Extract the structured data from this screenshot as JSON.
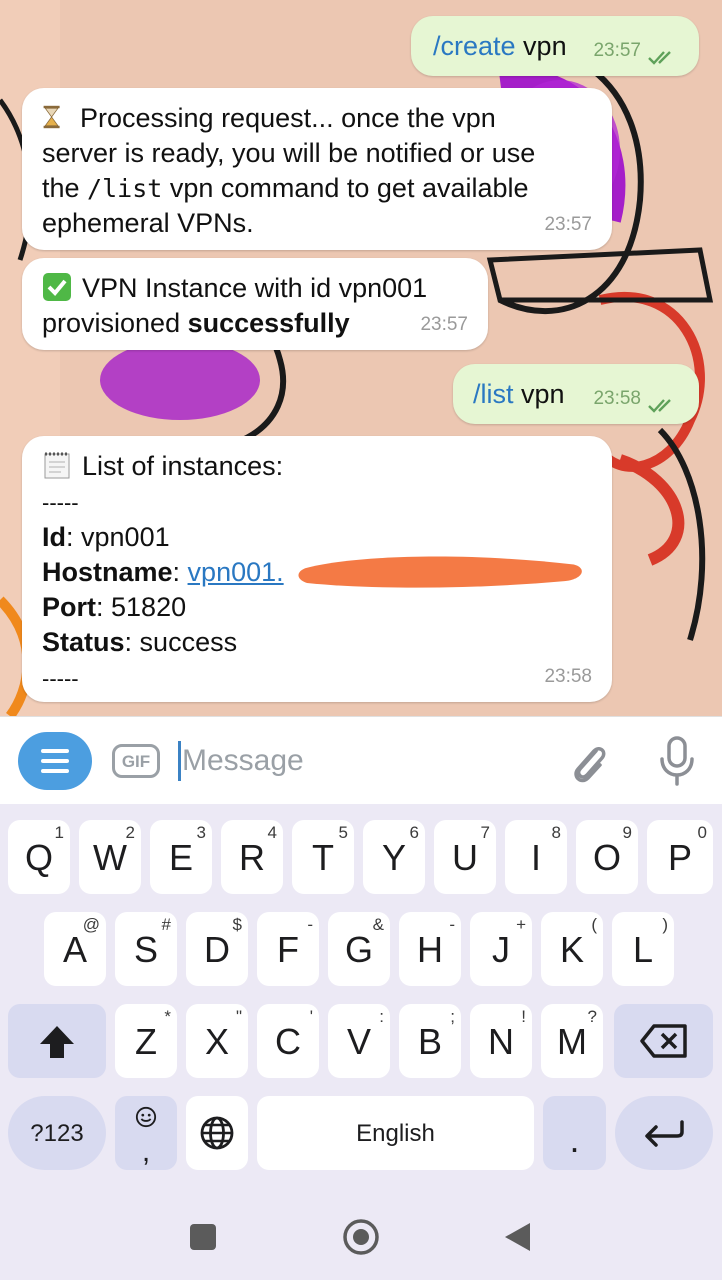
{
  "messages": {
    "out1": {
      "command": "/create",
      "text": " vpn",
      "time": "23:57"
    },
    "in1": {
      "line1": "Processing request... once the vpn",
      "line2": "server is ready, you will be notified or use",
      "line3_pre": "the ",
      "line3_code": "/list",
      "line3_post": " vpn command to get available",
      "line4": "ephemeral VPNs.",
      "time": "23:57"
    },
    "in2": {
      "line1": "VPN Instance with id vpn001",
      "line2_pre": "provisioned ",
      "line2_bold": "successfully",
      "time": "23:57"
    },
    "out2": {
      "command": "/list",
      "text": " vpn",
      "time": "23:58"
    },
    "in3": {
      "title": "List of instances:",
      "separator": "-----",
      "id_label": "Id",
      "id_value": " vpn001",
      "hostname_label": "Hostname",
      "hostname_value": "vpn001.",
      "port_label": "Port",
      "port_value": " 51820",
      "status_label": "Status",
      "status_value": " success",
      "separator_end": "-----",
      "time": "23:58"
    }
  },
  "composer": {
    "gif_label": "GIF",
    "placeholder": "Message"
  },
  "keyboard": {
    "row1": [
      [
        "Q",
        "1"
      ],
      [
        "W",
        "2"
      ],
      [
        "E",
        "3"
      ],
      [
        "R",
        "4"
      ],
      [
        "T",
        "5"
      ],
      [
        "Y",
        "6"
      ],
      [
        "U",
        "7"
      ],
      [
        "I",
        "8"
      ],
      [
        "O",
        "9"
      ],
      [
        "P",
        "0"
      ]
    ],
    "row2": [
      [
        "A",
        "@"
      ],
      [
        "S",
        "#"
      ],
      [
        "D",
        "$"
      ],
      [
        "F",
        "-"
      ],
      [
        "G",
        "&"
      ],
      [
        "H",
        "-"
      ],
      [
        "J",
        "+"
      ],
      [
        "K",
        "("
      ],
      [
        "L",
        ")"
      ]
    ],
    "row3": [
      [
        "Z",
        "*"
      ],
      [
        "X",
        "\""
      ],
      [
        "C",
        "'"
      ],
      [
        "V",
        ":"
      ],
      [
        "B",
        ";"
      ],
      [
        "N",
        "!"
      ],
      [
        "M",
        "?"
      ]
    ],
    "symbols_label": "?123",
    "space_label": "English",
    "period_label": ".",
    "comma_label": ","
  },
  "colors": {
    "accent": "#4c9ee0",
    "link": "#2a78c2",
    "outgoing_bubble": "#e6f6d3",
    "redaction": "#f47a45"
  }
}
